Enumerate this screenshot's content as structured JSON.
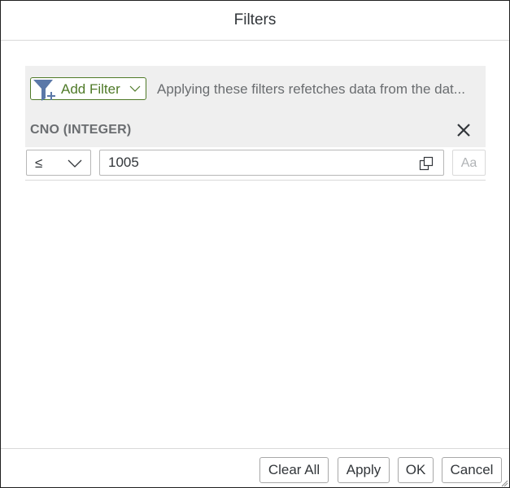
{
  "dialog": {
    "title": "Filters"
  },
  "toolbar": {
    "add_filter_label": "Add Filter",
    "add_filter_icon": "funnel-plus-icon",
    "info_text": "Applying these filters refetches data from the dat..."
  },
  "filter": {
    "field_label": "CNO (INTEGER)",
    "operator": "≤",
    "value": "1005",
    "case_label": "Aa"
  },
  "footer": {
    "clear_all": "Clear All",
    "apply": "Apply",
    "ok": "OK",
    "cancel": "Cancel"
  },
  "colors": {
    "accent_green": "#4f7a28",
    "funnel_blue": "#5b78a8",
    "panel_gray": "#efefef"
  }
}
